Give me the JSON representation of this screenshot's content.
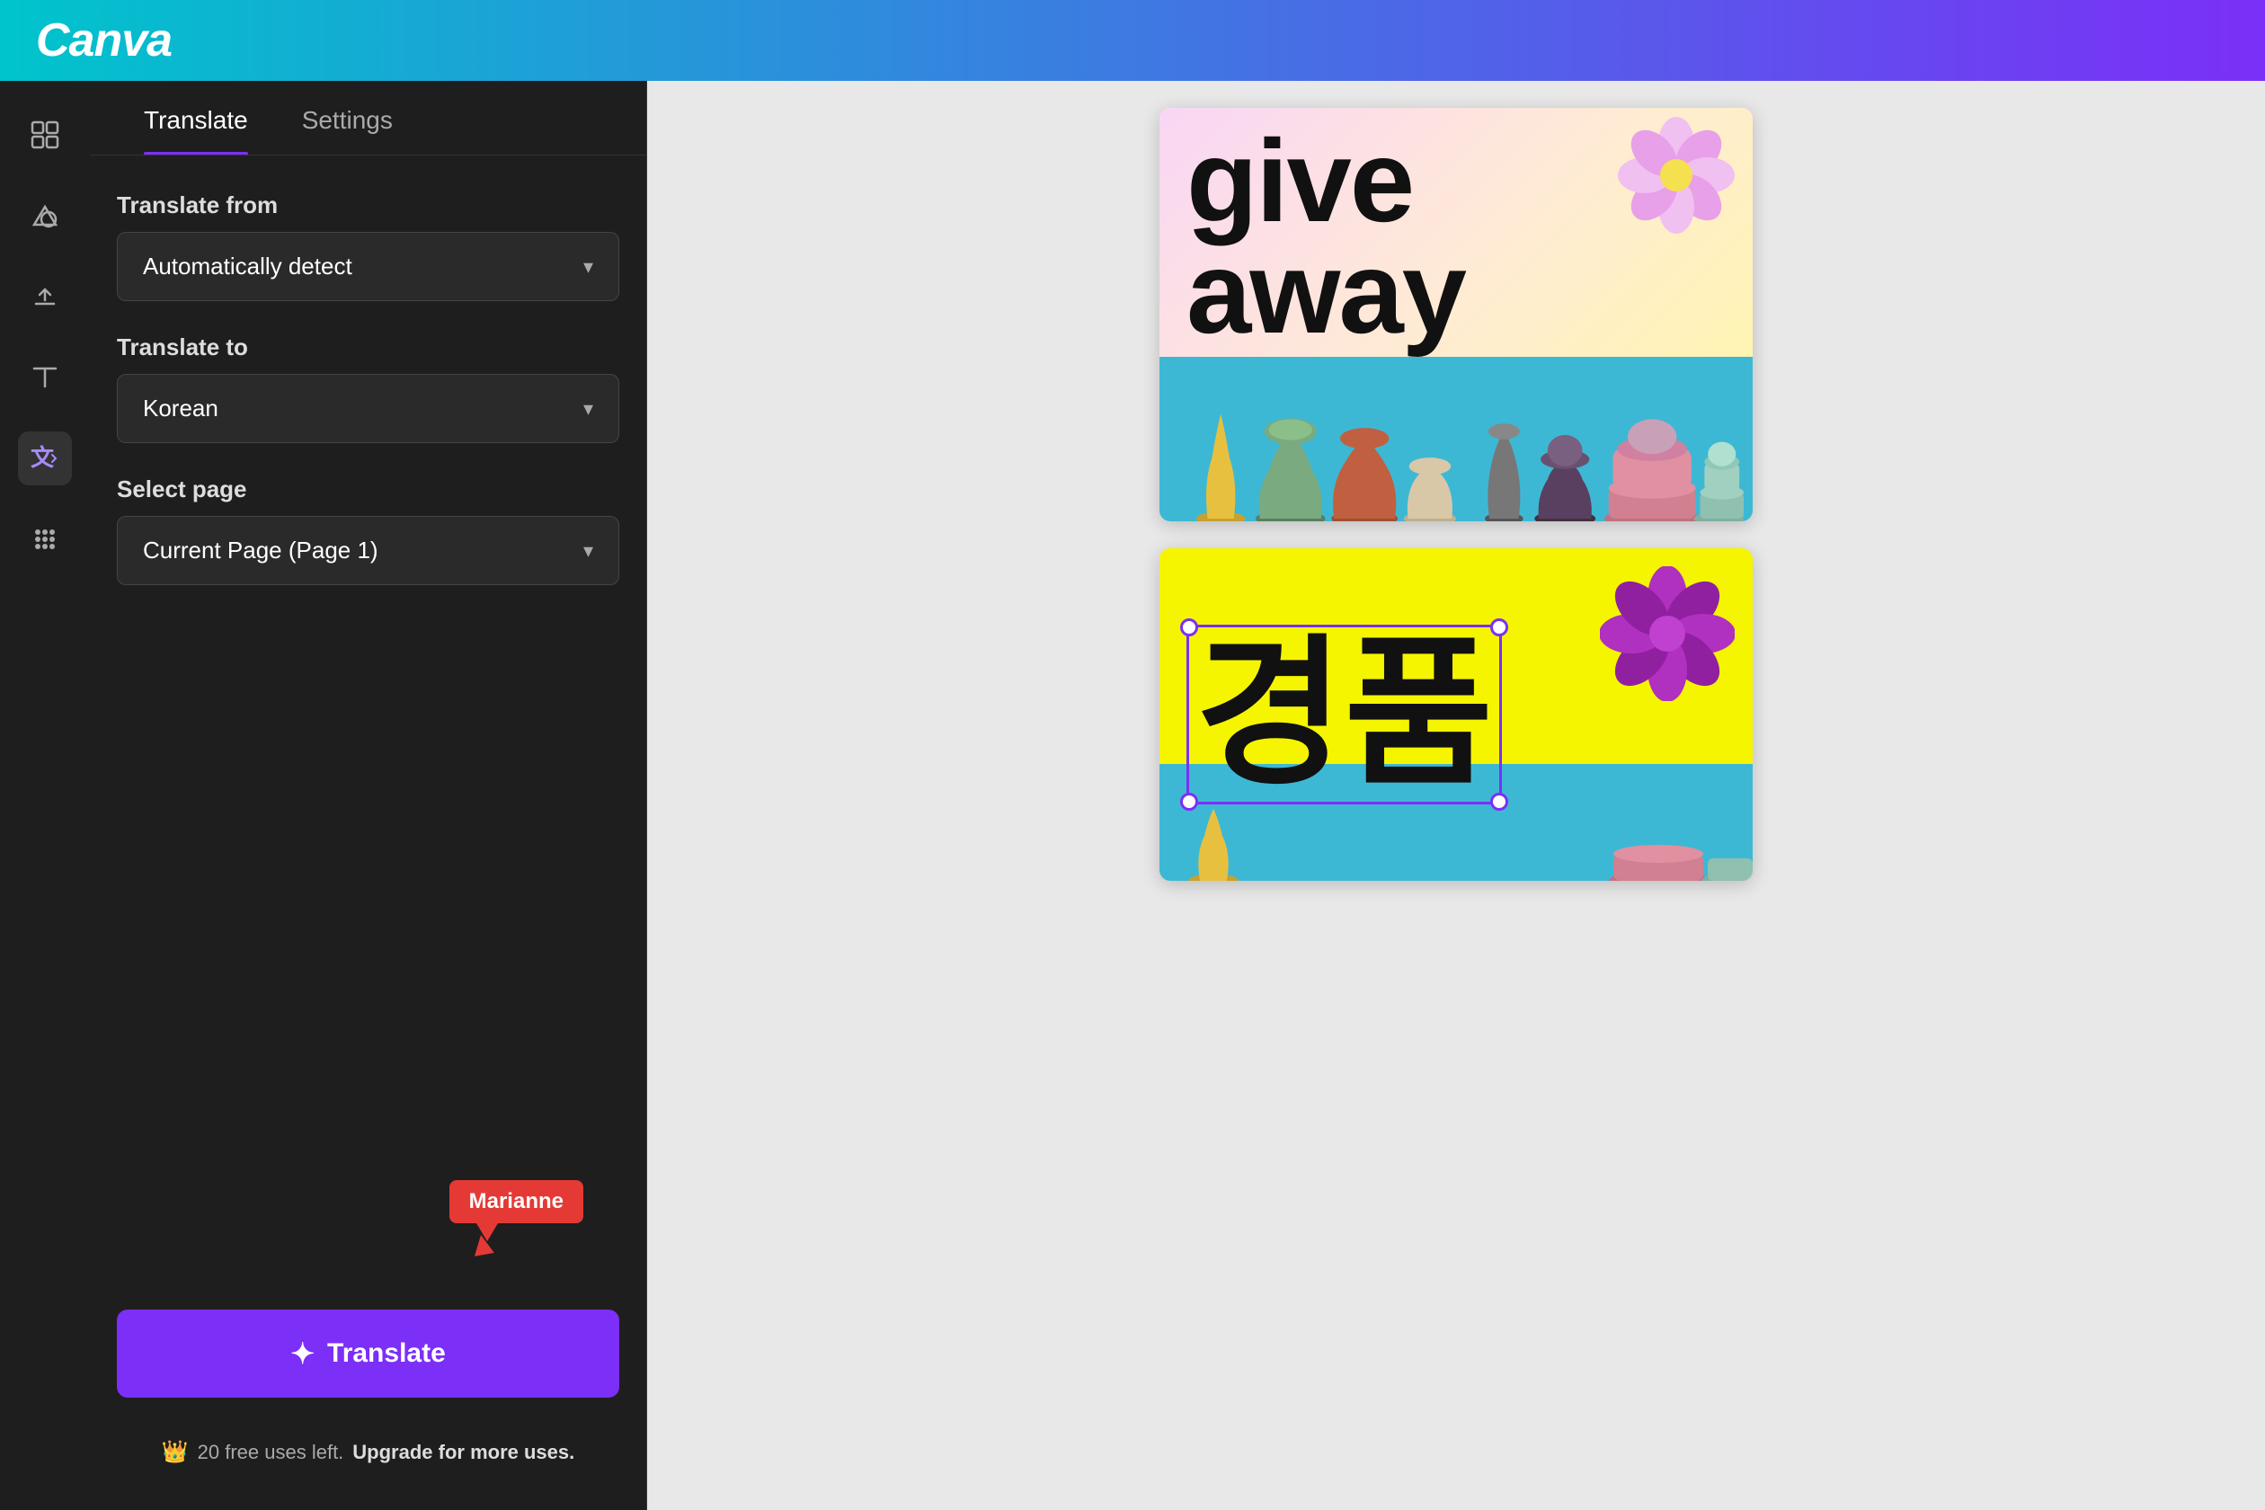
{
  "topbar": {
    "logo": "Canva"
  },
  "sidebar": {
    "icons": [
      {
        "name": "grid-icon",
        "symbol": "⊞",
        "label": "Elements"
      },
      {
        "name": "shapes-icon",
        "symbol": "◇♡",
        "label": "Shapes"
      },
      {
        "name": "upload-icon",
        "symbol": "↑",
        "label": "Upload"
      },
      {
        "name": "text-icon",
        "symbol": "T",
        "label": "Text"
      },
      {
        "name": "translate-icon",
        "symbol": "✱A",
        "label": "Translate",
        "active": true
      },
      {
        "name": "apps-icon",
        "symbol": "⋮⋮⋮",
        "label": "Apps"
      }
    ]
  },
  "panel": {
    "tabs": [
      {
        "label": "Translate",
        "active": true
      },
      {
        "label": "Settings",
        "active": false
      }
    ],
    "translate_from_label": "Translate from",
    "translate_from_value": "Automatically detect",
    "translate_to_label": "Translate to",
    "translate_to_value": "Korean",
    "select_page_label": "Select page",
    "select_page_value": "Current Page (Page 1)",
    "translate_btn_label": "Translate",
    "user_name": "Marianne",
    "free_uses_text": "20 free uses left.",
    "upgrade_text": "Upgrade for more uses."
  },
  "canvas": {
    "card1": {
      "text_line1": "give",
      "text_line2": "away"
    },
    "card2": {
      "korean_text": "경품"
    }
  }
}
